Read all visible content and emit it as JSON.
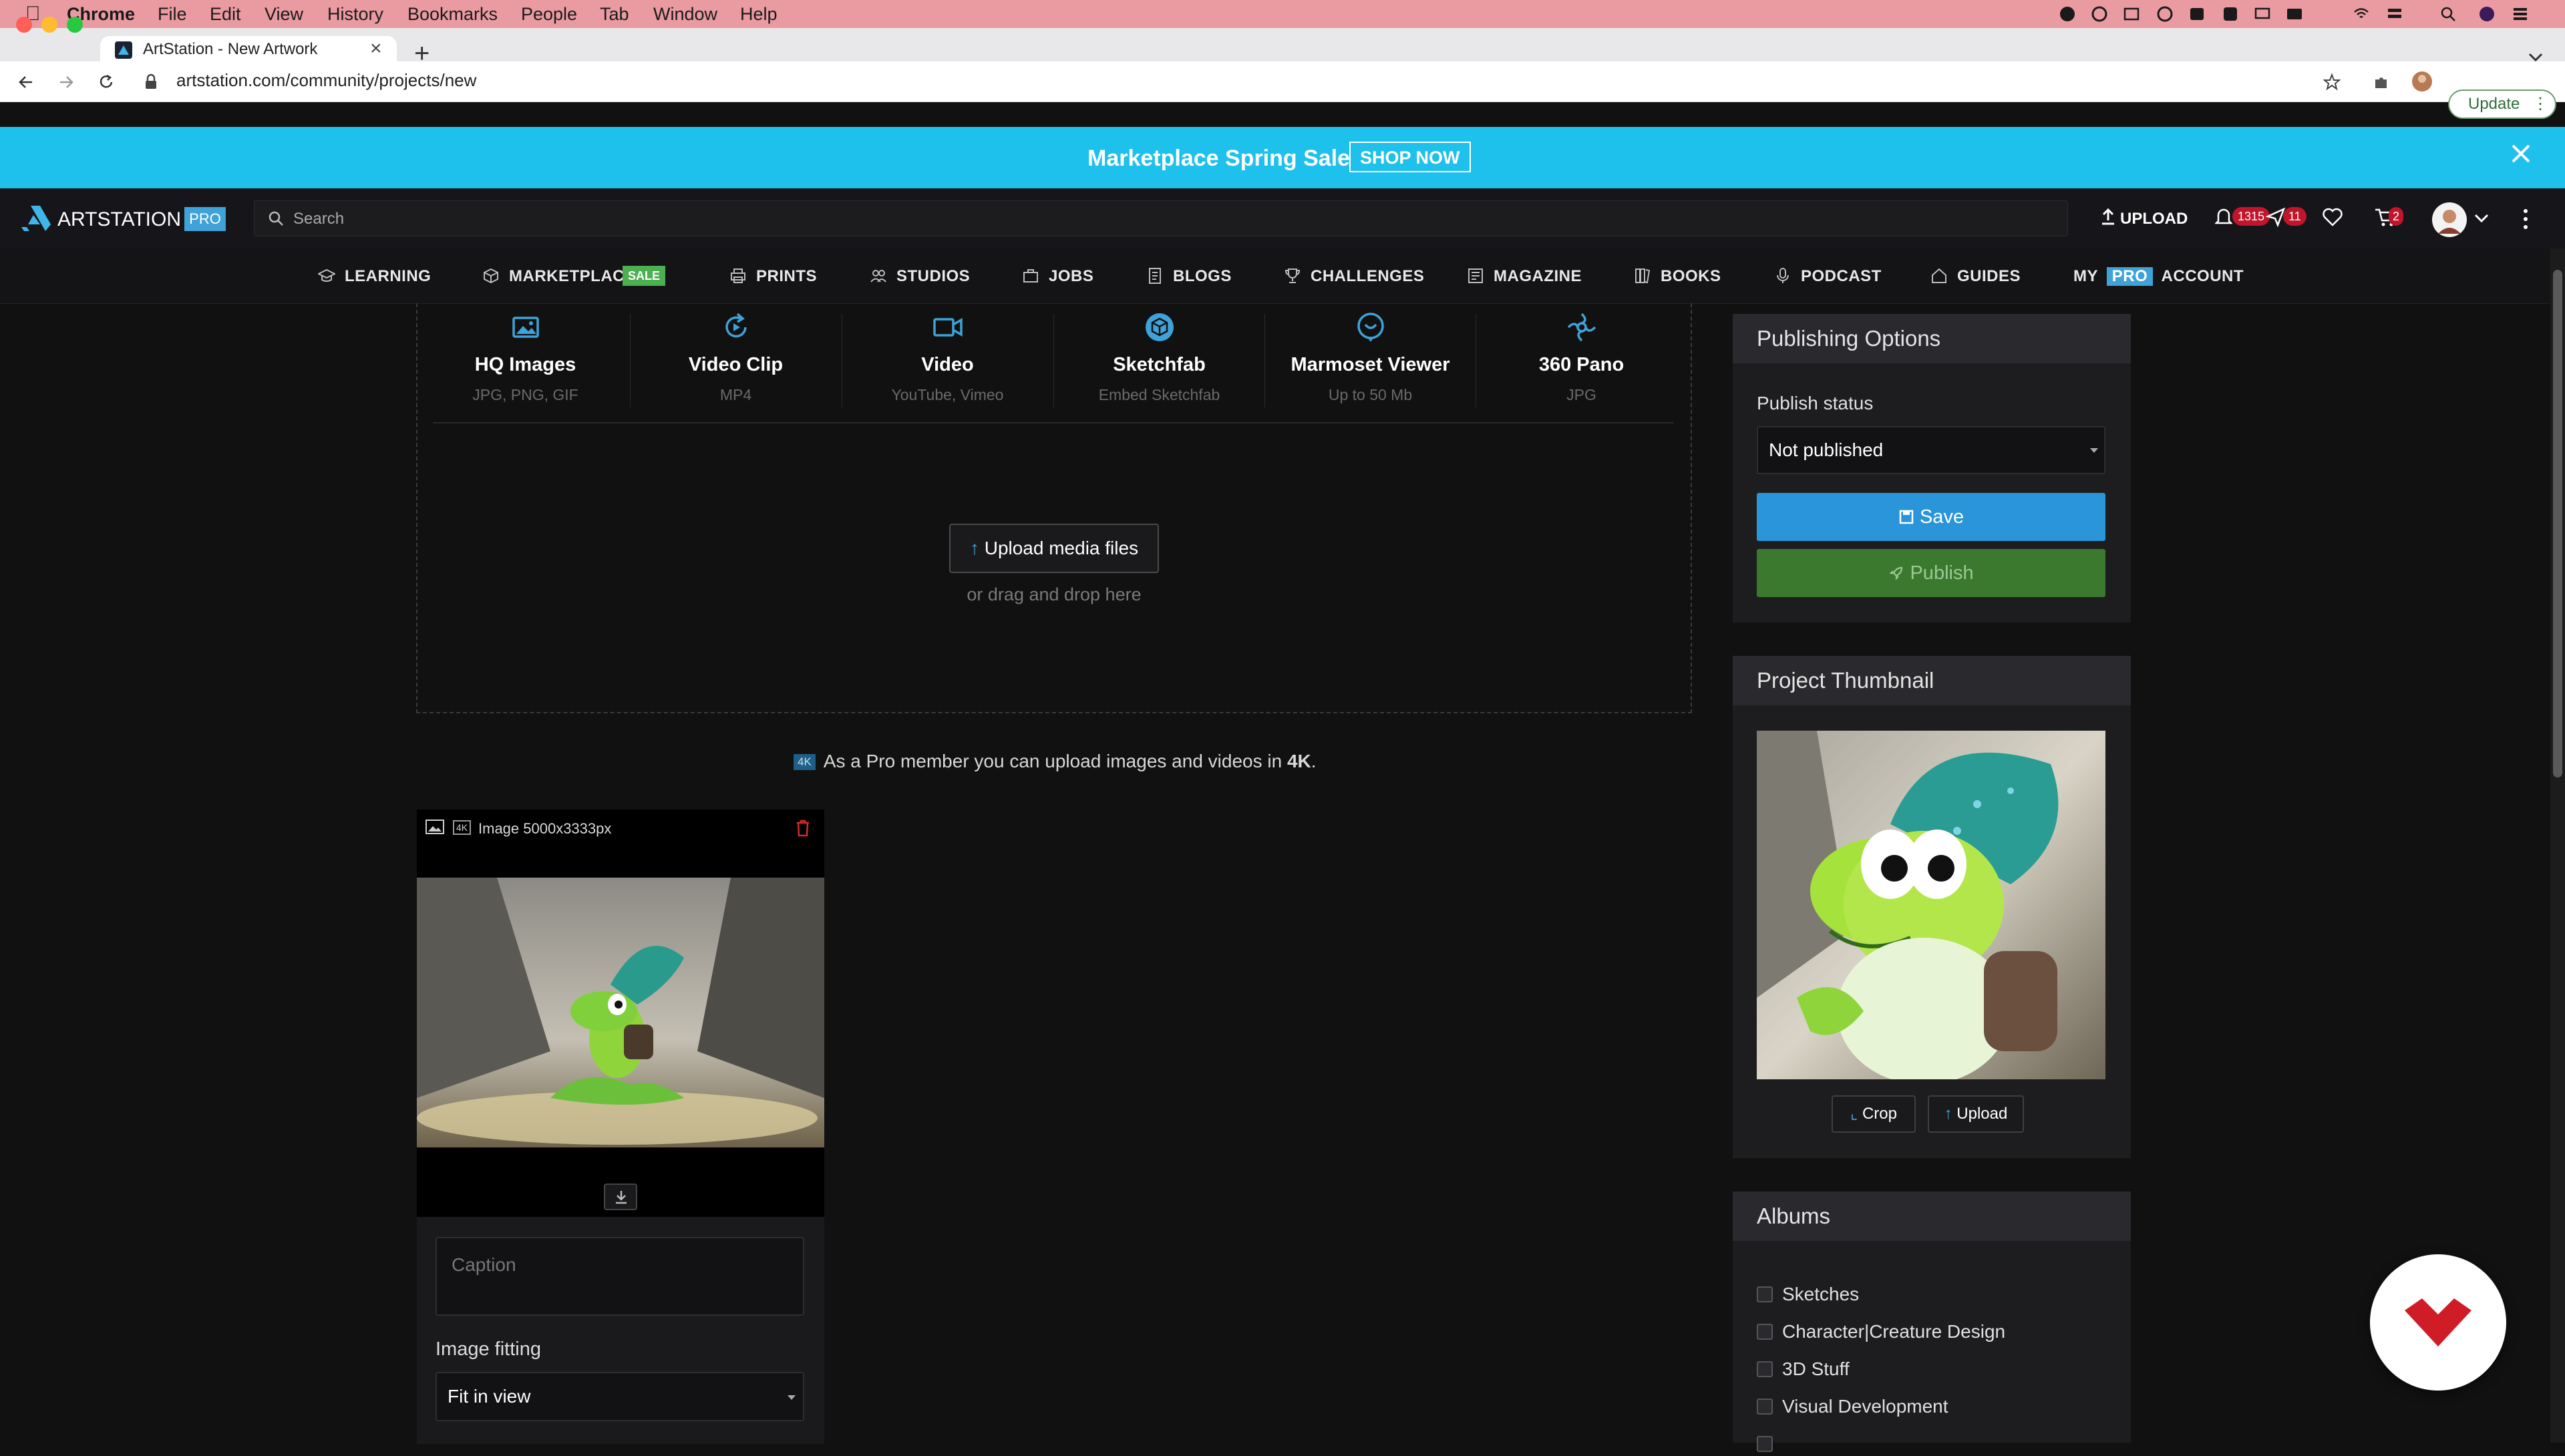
{
  "menubar": {
    "app": "Chrome",
    "items": [
      "File",
      "Edit",
      "View",
      "History",
      "Bookmarks",
      "People",
      "Tab",
      "Window",
      "Help"
    ]
  },
  "browser": {
    "tab_title": "ArtStation - New Artwork",
    "url": "artstation.com/community/projects/new",
    "update_label": "Update"
  },
  "banner": {
    "text": "Marketplace Spring Sale",
    "cta": "SHOP NOW"
  },
  "header": {
    "logo": "ARTSTATION",
    "pro_badge": "PRO",
    "search_placeholder": "Search",
    "upload_label": "UPLOAD",
    "notifications_count": "1315",
    "messages_count": "11",
    "cart_count": "2"
  },
  "nav": {
    "items": [
      {
        "label": "LEARNING",
        "icon": "graduation-cap-icon"
      },
      {
        "label": "MARKETPLACE",
        "icon": "cube-icon",
        "badge": "SALE"
      },
      {
        "label": "PRINTS",
        "icon": "print-icon"
      },
      {
        "label": "STUDIOS",
        "icon": "users-icon"
      },
      {
        "label": "JOBS",
        "icon": "briefcase-icon"
      },
      {
        "label": "BLOGS",
        "icon": "document-icon"
      },
      {
        "label": "CHALLENGES",
        "icon": "trophy-icon"
      },
      {
        "label": "MAGAZINE",
        "icon": "magazine-icon"
      },
      {
        "label": "BOOKS",
        "icon": "books-icon"
      },
      {
        "label": "PODCAST",
        "icon": "microphone-icon"
      },
      {
        "label": "GUIDES",
        "icon": "home-icon"
      }
    ],
    "my_account": {
      "my": "MY",
      "pro": "PRO",
      "account": "ACCOUNT"
    }
  },
  "media_types": [
    {
      "title": "HQ Images",
      "subtitle": "JPG, PNG, GIF",
      "icon": "image-icon"
    },
    {
      "title": "Video Clip",
      "subtitle": "MP4",
      "icon": "refresh-video-icon"
    },
    {
      "title": "Video",
      "subtitle": "YouTube, Vimeo",
      "icon": "video-camera-icon"
    },
    {
      "title": "Sketchfab",
      "subtitle": "Embed Sketchfab",
      "icon": "sketchfab-icon"
    },
    {
      "title": "Marmoset Viewer",
      "subtitle": "Up to 50 Mb",
      "icon": "marmoset-icon"
    },
    {
      "title": "360 Pano",
      "subtitle": "JPG",
      "icon": "pano-icon"
    }
  ],
  "upload": {
    "button_label": "Upload media files",
    "drag_drop_text": "or drag and drop here",
    "pro_note_prefix": "As a Pro member you can upload images and videos in",
    "pro_note_bold": "4K",
    "pro_note_suffix": ".",
    "badge_4k": "4K"
  },
  "image_card": {
    "label": "Image 5000x3333px",
    "badge_4k": "4K",
    "caption_placeholder": "Caption",
    "fitting_label": "Image fitting",
    "fitting_value": "Fit in view"
  },
  "publishing": {
    "title": "Publishing Options",
    "status_label": "Publish status",
    "status_value": "Not published",
    "save_label": "Save",
    "publish_label": "Publish"
  },
  "thumbnail": {
    "title": "Project Thumbnail",
    "crop_label": "Crop",
    "upload_label": "Upload"
  },
  "albums": {
    "title": "Albums",
    "items": [
      "Sketches",
      "Character|Creature Design",
      "3D Stuff",
      "Visual Development"
    ]
  },
  "colors": {
    "banner": "#1ec0ec",
    "accent_blue": "#2a95d8",
    "publish_green": "#3b7a2e",
    "badge_red": "#c0152a",
    "macos_menubar": "#ea9ba2",
    "chat_fab_red": "#d01c27"
  }
}
